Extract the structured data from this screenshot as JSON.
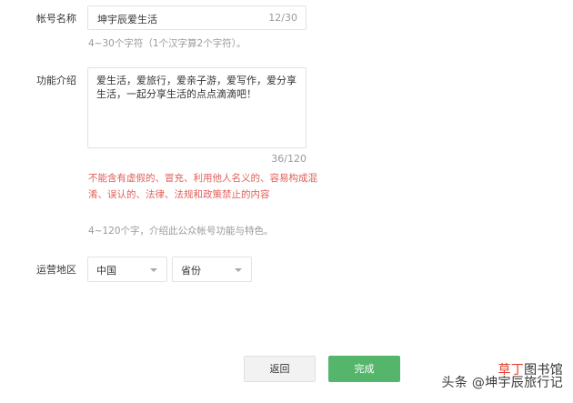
{
  "account_name": {
    "label": "帐号名称",
    "value": "坤宇辰爱生活",
    "counter": "12/30",
    "hint": "4~30个字符（1个汉字算2个字符）。"
  },
  "introduction": {
    "label": "功能介绍",
    "value": "爱生活，爱旅行，爱亲子游，爱写作，爱分享生活，一起分享生活的点点滴滴吧！",
    "counter": "36/120",
    "warning": "不能含有虚假的、冒充、利用他人名义的、容易构成混淆、误认的、法律、法规和政策禁止的内容",
    "hint": "4~120个字，介绍此公众帐号功能与特色。"
  },
  "region": {
    "label": "运营地区",
    "country": "中国",
    "province": "省份"
  },
  "buttons": {
    "back": "返回",
    "done": "完成"
  },
  "watermark": {
    "brand_part1": "草丁",
    "brand_part2": "图书馆",
    "text": "头条 @坤宇辰旅行记"
  }
}
